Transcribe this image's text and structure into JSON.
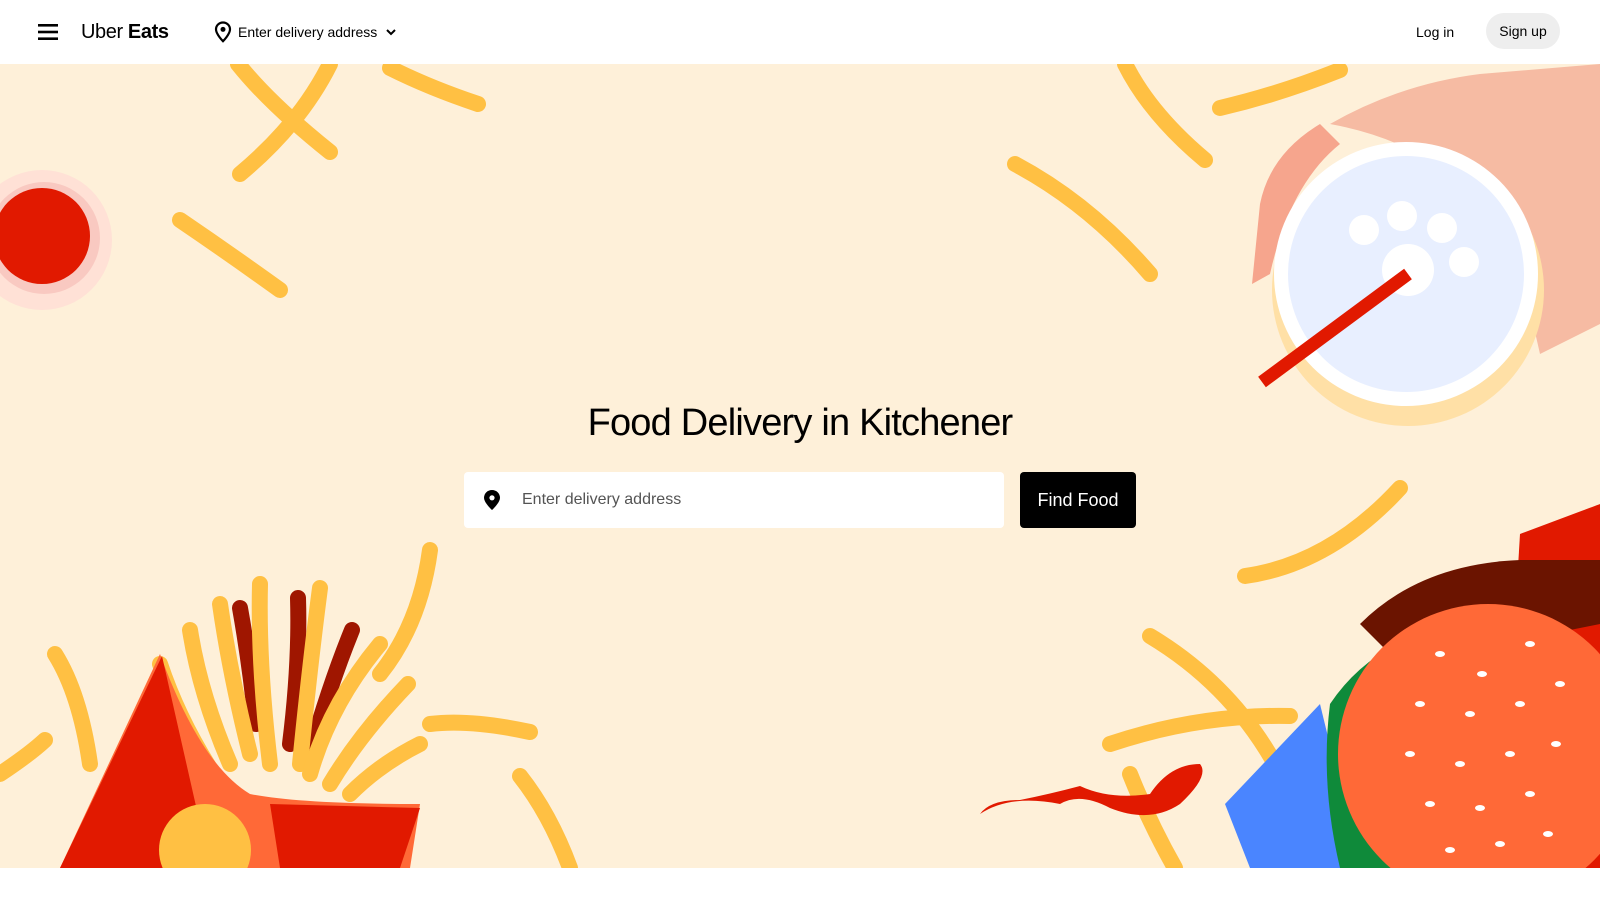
{
  "header": {
    "logo_light": "Uber",
    "logo_bold": "Eats",
    "address_label": "Enter delivery address",
    "login_label": "Log in",
    "signup_label": "Sign up"
  },
  "hero": {
    "title": "Food Delivery in Kitchener",
    "search_placeholder": "Enter delivery address",
    "find_button": "Find Food"
  },
  "colors": {
    "hero_bg": "#fef0d9",
    "fries": "#ffc043",
    "red": "#e11900",
    "orange": "#ff6937",
    "button": "#000000"
  }
}
